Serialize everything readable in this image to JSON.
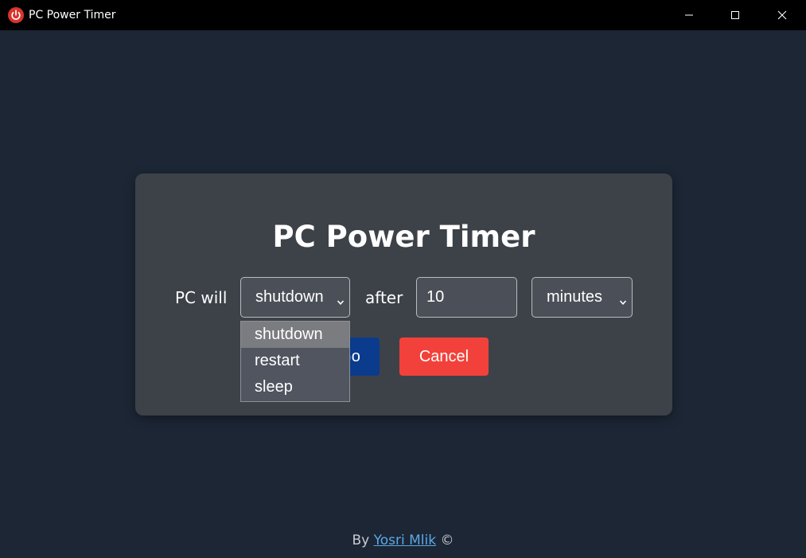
{
  "window": {
    "title": "PC Power Timer",
    "icon": "power-icon",
    "icon_color": "#d9342b",
    "controls": [
      "minimize-icon",
      "maximize-icon",
      "close-icon"
    ]
  },
  "card": {
    "heading": "PC Power Timer",
    "label_prefix": "PC will",
    "label_middle": "after",
    "action_select": {
      "value": "shutdown",
      "options": [
        "shutdown",
        "restart",
        "sleep"
      ],
      "expanded": true
    },
    "amount_input": {
      "value": "10"
    },
    "unit_select": {
      "value": "minutes"
    },
    "go_button_label": "Go",
    "cancel_button_label": "Cancel"
  },
  "footer": {
    "prefix": "By",
    "author_link": "Yosri Mlik",
    "suffix": "©"
  },
  "colors": {
    "background": "#1c2635",
    "card": "#3d4249",
    "go_button": "#0a3b8c",
    "cancel_button": "#f2413a",
    "link": "#5aa9e6"
  }
}
